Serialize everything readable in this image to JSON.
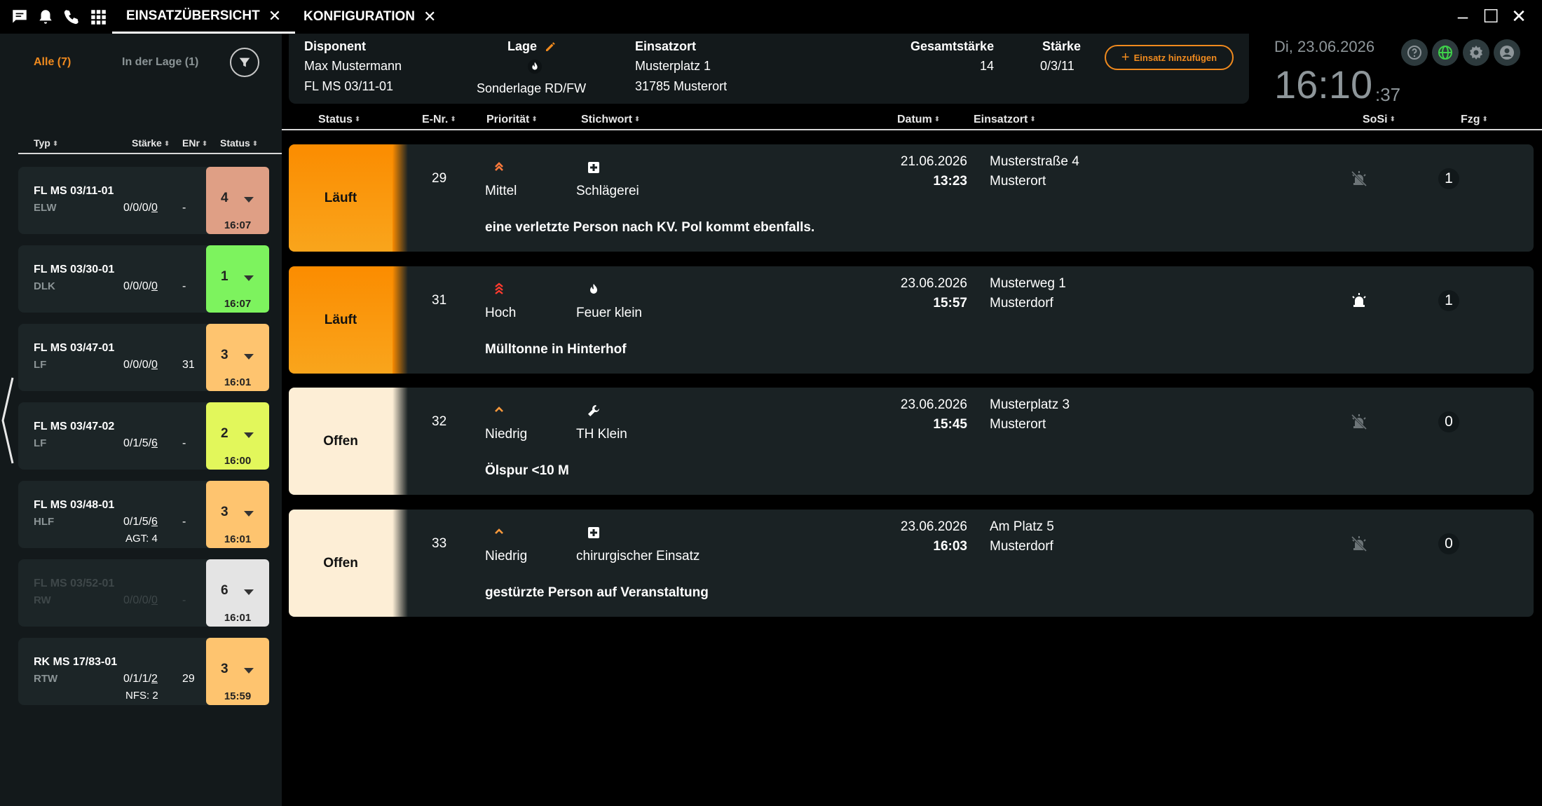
{
  "topbar": {
    "tabs": [
      {
        "label": "EINSATZÜBERSICHT",
        "close": "✕"
      },
      {
        "label": "KONFIGURATION",
        "close": "✕"
      }
    ],
    "icons": [
      "chat-icon",
      "bell-icon",
      "phone-icon",
      "apps-grid-icon"
    ],
    "window": {
      "minimize": "–",
      "maximize": "☐",
      "close": "✕"
    }
  },
  "left": {
    "tabs": {
      "all": "Alle (7)",
      "in_lage": "In der Lage (1)"
    },
    "headers": {
      "typ": "Typ",
      "staerke": "Stärke",
      "enr": "ENr",
      "status": "Status"
    },
    "units": [
      {
        "name": "FL MS 03/11-01",
        "typ": "ELW",
        "st_prefix": "0/0/0/",
        "st_last": "0",
        "enr": "-",
        "extra": "",
        "status": "4",
        "time": "16:07",
        "color": "#df9f85",
        "dim": false
      },
      {
        "name": "FL MS 03/30-01",
        "typ": "DLK",
        "st_prefix": "0/0/0/",
        "st_last": "0",
        "enr": "-",
        "extra": "",
        "status": "1",
        "time": "16:07",
        "color": "#7df35e",
        "dim": false
      },
      {
        "name": "FL MS 03/47-01",
        "typ": "LF",
        "st_prefix": "0/0/0/",
        "st_last": "0",
        "enr": "31",
        "extra": "",
        "status": "3",
        "time": "16:01",
        "color": "#fec46f",
        "dim": false
      },
      {
        "name": "FL MS 03/47-02",
        "typ": "LF",
        "st_prefix": "0/1/5/",
        "st_last": "6",
        "enr": "-",
        "extra": "",
        "status": "2",
        "time": "16:00",
        "color": "#e2f75b",
        "dim": false
      },
      {
        "name": "FL MS 03/48-01",
        "typ": "HLF",
        "st_prefix": "0/1/5/",
        "st_last": "6",
        "enr": "-",
        "extra": "AGT: 4",
        "status": "3",
        "time": "16:01",
        "color": "#fec46f",
        "dim": false
      },
      {
        "name": "FL MS 03/52-01",
        "typ": "RW",
        "st_prefix": "0/0/0/",
        "st_last": "0",
        "enr": "-",
        "extra": "",
        "status": "6",
        "time": "16:01",
        "color": "#e4e4e4",
        "dim": true
      },
      {
        "name": "RK MS 17/83-01",
        "typ": "RTW",
        "st_prefix": "0/1/1/",
        "st_last": "2",
        "enr": "29",
        "extra": "NFS: 2",
        "status": "3",
        "time": "15:59",
        "color": "#fec46f",
        "dim": false
      }
    ]
  },
  "header": {
    "disponent_label": "Disponent",
    "disponent_name": "Max Mustermann",
    "disponent_unit": "FL MS 03/11-01",
    "lage_label": "Lage",
    "lage_value": "Sonderlage RD/FW",
    "einsatzort_label": "Einsatzort",
    "einsatzort_street": "Musterplatz 1",
    "einsatzort_city": "31785 Musterort",
    "gesamtstaerke_label": "Gesamtstärke",
    "gesamtstaerke_value": "14",
    "staerke_label": "Stärke",
    "staerke_value": "0/3/11",
    "add_button": "Einsatz hinzufügen"
  },
  "clock": {
    "date": "Di, 23.06.2026",
    "time": "16:10",
    "seconds": ":37"
  },
  "table": {
    "headers": {
      "status": "Status",
      "enr": "E-Nr.",
      "prioritaet": "Priorität",
      "stichwort": "Stichwort",
      "datum": "Datum",
      "einsatzort": "Einsatzort",
      "sosi": "SoSi",
      "fzg": "Fzg"
    },
    "incidents": [
      {
        "status": "Läuft",
        "status_color": "#fb8c00",
        "enr": "29",
        "priority": "Mittel",
        "priority_icon": "chevron-double-up-icon",
        "priority_color": "#ff7a3c",
        "keyword": "Schlägerei",
        "keyword_icon": "medical-cross-icon",
        "date": "21.06.2026",
        "time": "13:23",
        "loc_street": "Musterstraße 4",
        "loc_city": "Musterort",
        "desc": "eine verletzte Person nach KV. Pol kommt ebenfalls.",
        "sosi_icon": "siren-off-icon",
        "fzg": "1"
      },
      {
        "status": "Läuft",
        "status_color": "#fb8c00",
        "enr": "31",
        "priority": "Hoch",
        "priority_icon": "chevron-triple-up-icon",
        "priority_color": "#ff3b2f",
        "keyword": "Feuer klein",
        "keyword_icon": "flame-icon",
        "date": "23.06.2026",
        "time": "15:57",
        "loc_street": "Musterweg 1",
        "loc_city": "Musterdorf",
        "desc": "Mülltonne in Hinterhof",
        "sosi_icon": "siren-on-icon",
        "fzg": "1"
      },
      {
        "status": "Offen",
        "status_color": "#fdeed6",
        "enr": "32",
        "priority": "Niedrig",
        "priority_icon": "chevron-up-icon",
        "priority_color": "#ff9a3c",
        "keyword": "TH Klein",
        "keyword_icon": "wrench-icon",
        "date": "23.06.2026",
        "time": "15:45",
        "loc_street": "Musterplatz 3",
        "loc_city": "Musterort",
        "desc": "Ölspur <10 M",
        "sosi_icon": "siren-off-icon",
        "fzg": "0"
      },
      {
        "status": "Offen",
        "status_color": "#fdeed6",
        "enr": "33",
        "priority": "Niedrig",
        "priority_icon": "chevron-up-icon",
        "priority_color": "#ff9a3c",
        "keyword": "chirurgischer Einsatz",
        "keyword_icon": "medical-cross-icon",
        "date": "23.06.2026",
        "time": "16:03",
        "loc_street": "Am Platz 5",
        "loc_city": "Musterdorf",
        "desc": "gestürzte Person auf Veranstaltung",
        "sosi_icon": "siren-off-icon",
        "fzg": "0"
      }
    ]
  },
  "colors": {
    "accent": "#f08a1e",
    "running": "#fb8c00",
    "open": "#fdeed6",
    "panel": "#13191b",
    "card": "#1a2224"
  }
}
